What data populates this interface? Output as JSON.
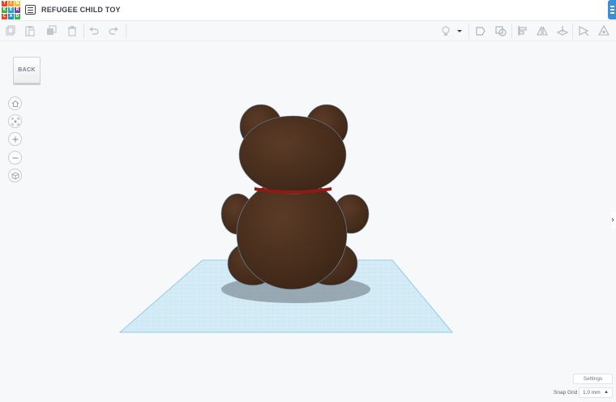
{
  "app": {
    "logo_letters": [
      "T",
      "I",
      "N",
      "K",
      "E",
      "R",
      "C",
      "A",
      "D"
    ],
    "logo_colors": [
      "#e8462b",
      "#f49a28",
      "#f4c430",
      "#3cb14a",
      "#2c9ad8",
      "#7f3f98",
      "#e8462b",
      "#1d8fd0",
      "#3cb14a"
    ],
    "design_title": "REFUGEE CHILD TOY"
  },
  "toolbar": {
    "left_tools": [
      "copy-icon",
      "paste-icon",
      "duplicate-icon",
      "delete-icon",
      "undo-icon",
      "redo-icon"
    ],
    "right_tools": [
      "light-bulb-icon",
      "dropdown-arrow-icon",
      "shape-icon",
      "group-icon",
      "align-icon",
      "mirror-icon",
      "workplane-icon",
      "ruler-icon",
      "notes-icon"
    ]
  },
  "canvas": {
    "back_label": "BACK",
    "view_controls": [
      "home-view-icon",
      "fit-view-icon",
      "zoom-in-icon",
      "zoom-out-icon",
      "perspective-icon"
    ],
    "model_color": "#4a2f1e",
    "ribbon_color": "#8f1a14",
    "workplane_color": "#d4ecf6"
  },
  "footer": {
    "settings_label": "Settings",
    "snap_grid_label": "Snap Grid",
    "snap_grid_value": "1.0 mm"
  }
}
